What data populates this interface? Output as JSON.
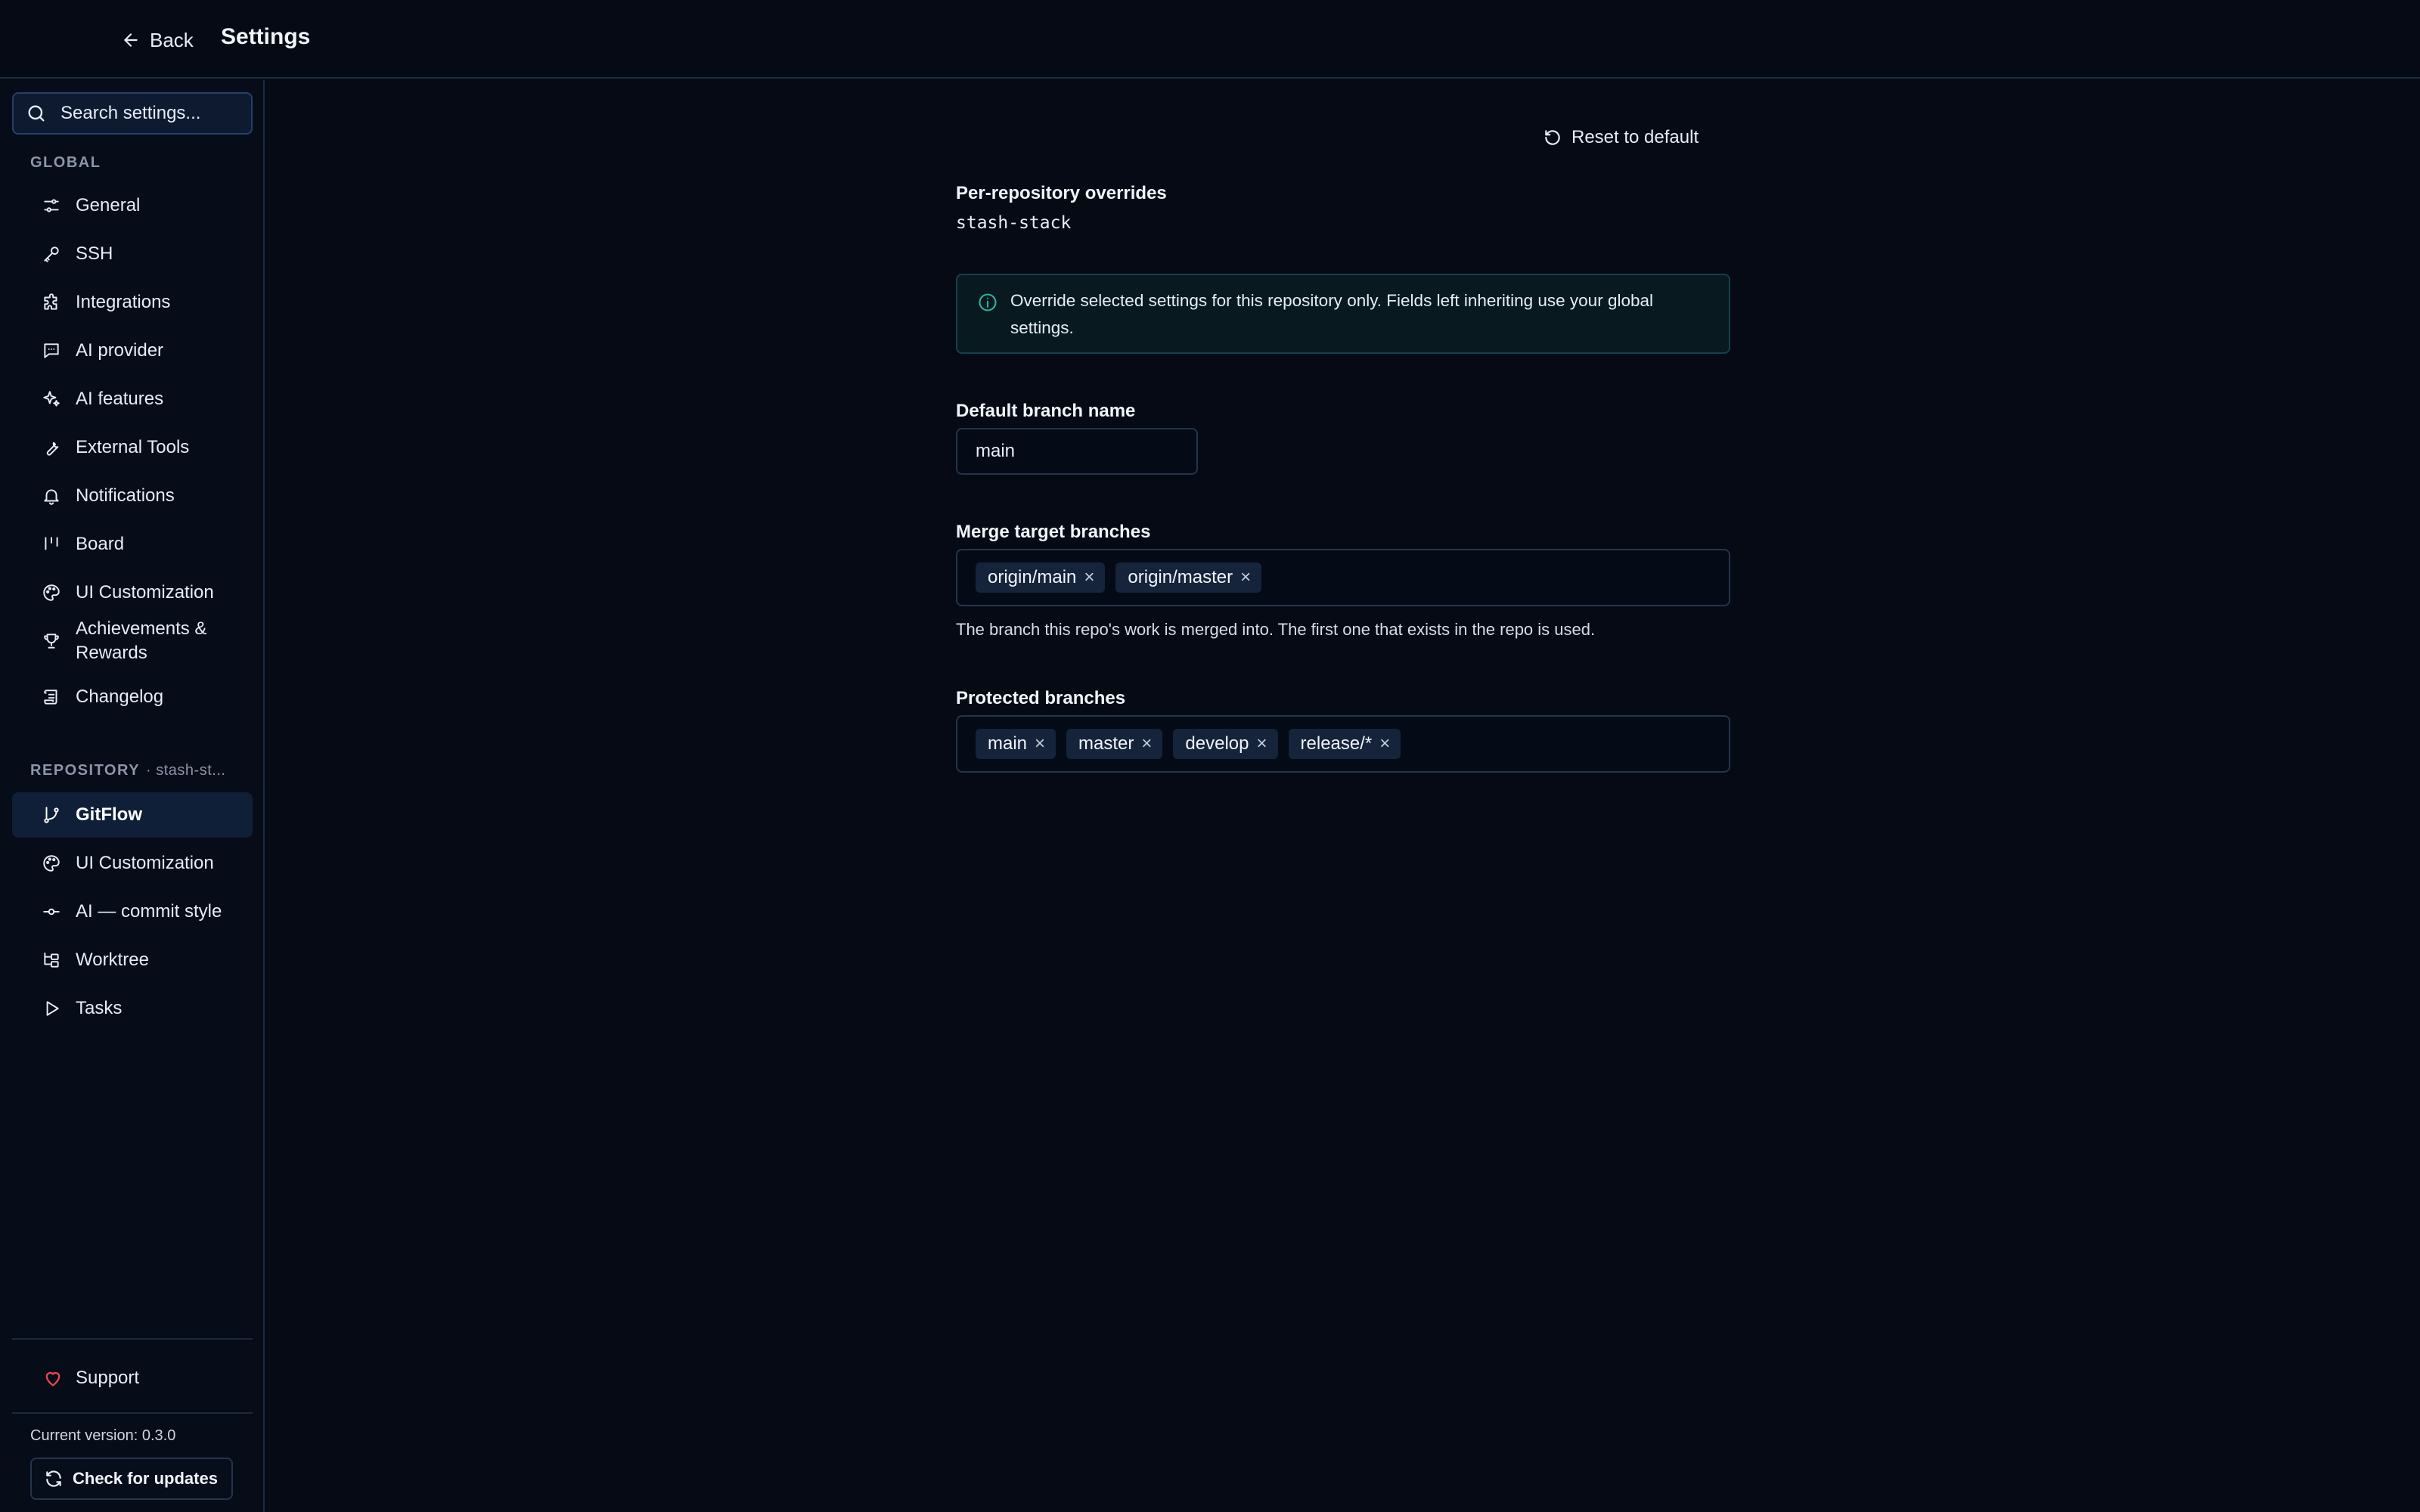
{
  "header": {
    "back_label": "Back",
    "title": "Settings"
  },
  "sidebar": {
    "search_placeholder": "Search settings...",
    "global_label": "GLOBAL",
    "global_items": [
      {
        "label": "General",
        "icon": "sliders-icon"
      },
      {
        "label": "SSH",
        "icon": "key-icon"
      },
      {
        "label": "Integrations",
        "icon": "puzzle-icon"
      },
      {
        "label": "AI provider",
        "icon": "chat-bubble-icon"
      },
      {
        "label": "AI features",
        "icon": "sparkles-icon"
      },
      {
        "label": "External Tools",
        "icon": "wrench-icon"
      },
      {
        "label": "Notifications",
        "icon": "bell-icon"
      },
      {
        "label": "Board",
        "icon": "board-columns-icon"
      },
      {
        "label": "UI Customization",
        "icon": "palette-icon"
      },
      {
        "label": "Achievements & Rewards",
        "icon": "trophy-icon"
      },
      {
        "label": "Changelog",
        "icon": "scroll-icon"
      }
    ],
    "repo_label": "REPOSITORY",
    "repo_sub": "· stash-st...",
    "repo_items": [
      {
        "label": "GitFlow",
        "icon": "git-branch-icon",
        "active": true
      },
      {
        "label": "UI Customization",
        "icon": "palette-icon"
      },
      {
        "label": "AI — commit style",
        "icon": "git-commit-icon"
      },
      {
        "label": "Worktree",
        "icon": "folder-tree-icon"
      },
      {
        "label": "Tasks",
        "icon": "play-icon"
      }
    ],
    "support_label": "Support",
    "version_text": "Current version: 0.3.0",
    "update_label": "Check for updates"
  },
  "main": {
    "reset_label": "Reset to default",
    "section_title": "Per-repository overrides",
    "repo_name": "stash-stack",
    "info_text": "Override selected settings for this repository only. Fields left inheriting use your global settings.",
    "default_branch": {
      "label": "Default branch name",
      "value": "main"
    },
    "merge_targets": {
      "label": "Merge target branches",
      "tags": [
        "origin/main",
        "origin/master"
      ],
      "help": "The branch this repo's work is merged into. The first one that exists in the repo is used."
    },
    "protected": {
      "label": "Protected branches",
      "tags": [
        "main",
        "master",
        "develop",
        "release/*"
      ]
    },
    "tag_remove_glyph": "×"
  },
  "colors": {
    "background": "#050a15",
    "active_item": "#0f1f38",
    "info_icon": "#2bb3a0",
    "support_heart": "#e5484d"
  }
}
